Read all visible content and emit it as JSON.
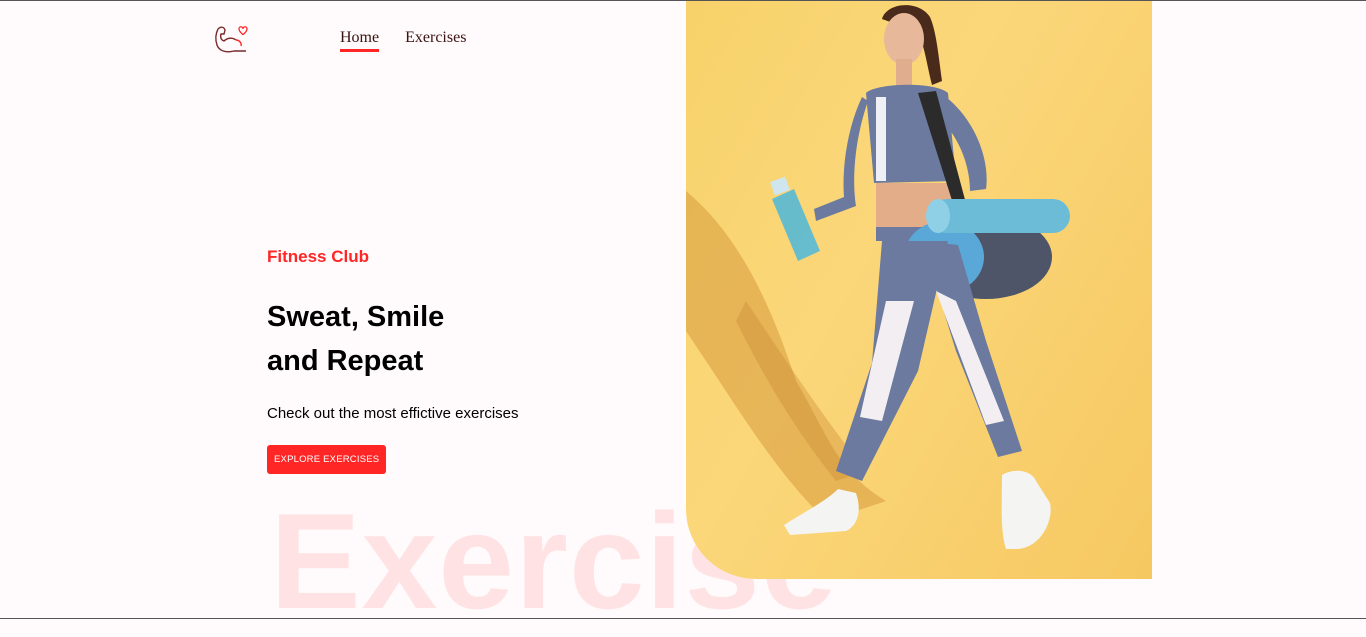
{
  "nav": {
    "logo_icon": "flexed-arm-heart-icon",
    "links": [
      {
        "label": "Home",
        "active": true
      },
      {
        "label": "Exercises",
        "active": false
      }
    ]
  },
  "hero": {
    "kicker": "Fitness Club",
    "headline_line1": "Sweat, Smile",
    "headline_line2": "and Repeat",
    "subtext": "Check out the most effictive exercises",
    "cta_label": "EXPLORE EXERCISES",
    "background_word": "Exercise",
    "image_alt": "banner",
    "accent_color": "#ff2625"
  }
}
